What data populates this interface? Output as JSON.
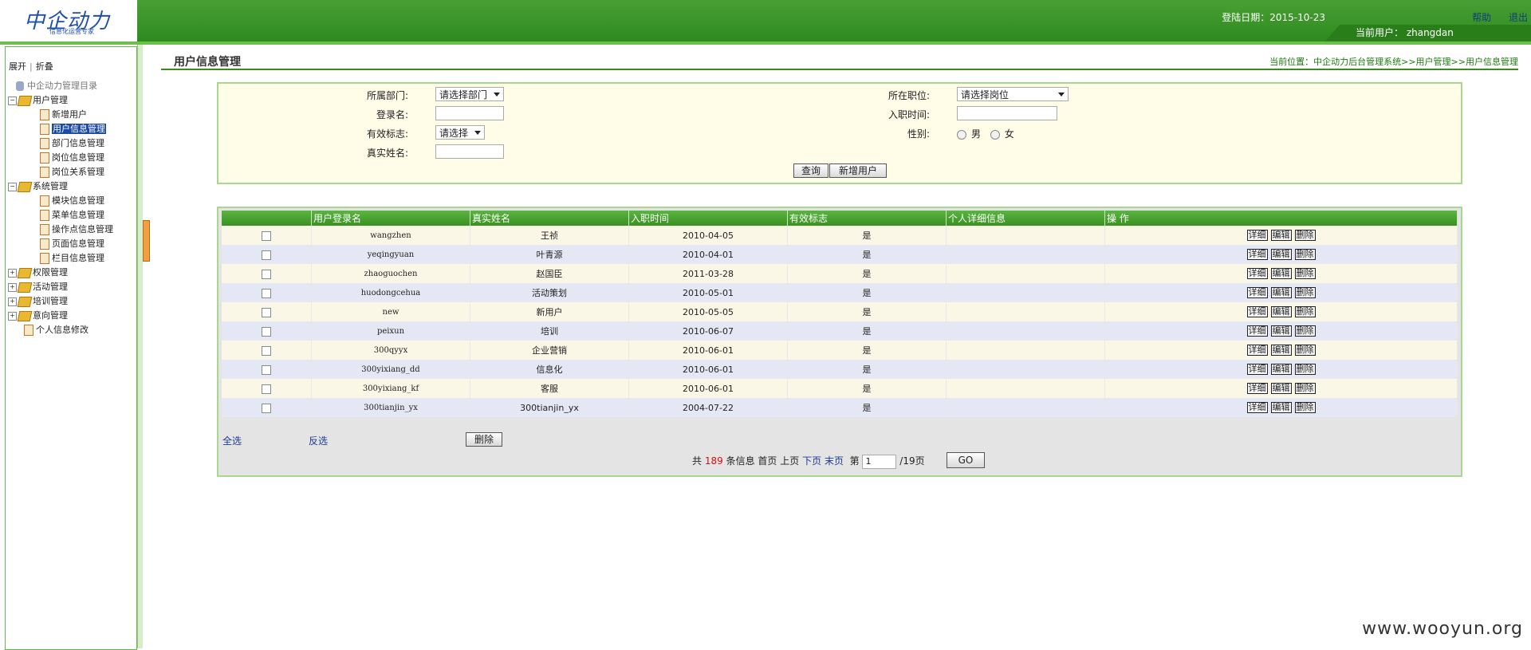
{
  "header": {
    "logo_text": "中企动力",
    "logo_sub": "信息化运营专家",
    "login_date": "登陆日期：2015-10-23",
    "help": "帮助",
    "logout": "退出",
    "current_user": "当前用户： zhangdan"
  },
  "sidebar": {
    "expand": "展开",
    "separator": "|",
    "collapse": "折叠",
    "root": "中企动力管理目录",
    "groups": [
      {
        "label": "用户管理",
        "toggle": "−",
        "items": [
          "新增用户",
          "用户信息管理",
          "部门信息管理",
          "岗位信息管理",
          "岗位关系管理"
        ]
      },
      {
        "label": "系统管理",
        "toggle": "−",
        "items": [
          "模块信息管理",
          "菜单信息管理",
          "操作点信息管理",
          "页面信息管理",
          "栏目信息管理"
        ]
      },
      {
        "label": "权限管理",
        "toggle": "+"
      },
      {
        "label": "活动管理",
        "toggle": "+"
      },
      {
        "label": "培训管理",
        "toggle": "+"
      },
      {
        "label": "意向管理",
        "toggle": "+"
      }
    ],
    "personal": "个人信息修改"
  },
  "page": {
    "title": "用户信息管理",
    "breadcrumb": "当前位置：中企动力后台管理系统>>用户管理>>用户信息管理"
  },
  "search": {
    "dept_label": "所属部门:",
    "dept_value": "请选择部门",
    "login_label": "登录名:",
    "valid_label": "有效标志:",
    "valid_value": "请选择",
    "realname_label": "真实姓名:",
    "position_label": "所在职位:",
    "position_value": "请选择岗位",
    "hiredate_label": "入职时间:",
    "gender_label": "性别:",
    "male": "男",
    "female": "女",
    "query_btn": "查询",
    "add_btn": "新增用户"
  },
  "table": {
    "headers": [
      "",
      "用户登录名",
      "真实姓名",
      "入职时间",
      "有效标志",
      "个人详细信息",
      "操 作"
    ],
    "actions": [
      "详细",
      "编辑",
      "删除"
    ],
    "rows": [
      {
        "login": "wangzhen",
        "name": "王祯",
        "date": "2010-04-05",
        "valid": "是"
      },
      {
        "login": "yeqingyuan",
        "name": "叶青源",
        "date": "2010-04-01",
        "valid": "是"
      },
      {
        "login": "zhaoguochen",
        "name": "赵国臣",
        "date": "2011-03-28",
        "valid": "是"
      },
      {
        "login": "huodongcehua",
        "name": "活动策划",
        "date": "2010-05-01",
        "valid": "是"
      },
      {
        "login": "new",
        "name": "新用户",
        "date": "2010-05-05",
        "valid": "是"
      },
      {
        "login": "peixun",
        "name": "培训",
        "date": "2010-06-07",
        "valid": "是"
      },
      {
        "login": "300qyyx",
        "name": "企业营销",
        "date": "2010-06-01",
        "valid": "是"
      },
      {
        "login": "300yixiang_dd",
        "name": "信息化",
        "date": "2010-06-01",
        "valid": "是"
      },
      {
        "login": "300yixiang_kf",
        "name": "客服",
        "date": "2010-06-01",
        "valid": "是"
      },
      {
        "login": "300tianjin_yx",
        "name": "300tianjin_yx",
        "date": "2004-07-22",
        "valid": "是"
      }
    ],
    "select_all": "全选",
    "invert": "反选",
    "delete_btn": "删除"
  },
  "pager": {
    "total_prefix": "共",
    "total": "189",
    "total_suffix": "条信息",
    "first": "首页",
    "prev": "上页",
    "next": "下页",
    "last": "末页",
    "page_prefix": "第",
    "page_value": "1",
    "page_suffix": "/19页",
    "go": "GO"
  },
  "watermark": "www.wooyun.org",
  "colors": {
    "header_green": "#2d8a1f",
    "selected_blue": "#1a4aa5",
    "total_red": "#d01010"
  }
}
